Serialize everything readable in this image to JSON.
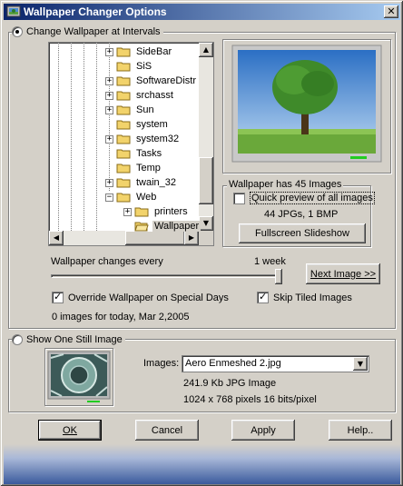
{
  "window": {
    "title": "Wallpaper Changer Options",
    "close_glyph": "✕"
  },
  "intervals": {
    "radio_label": "Change Wallpaper at Intervals",
    "selected": true,
    "tree": [
      {
        "label": "SideBar",
        "expandable": true
      },
      {
        "label": "SiS",
        "expandable": false
      },
      {
        "label": "SoftwareDistr",
        "expandable": true
      },
      {
        "label": "srchasst",
        "expandable": true
      },
      {
        "label": "Sun",
        "expandable": true
      },
      {
        "label": "system",
        "expandable": false
      },
      {
        "label": "system32",
        "expandable": true
      },
      {
        "label": "Tasks",
        "expandable": false
      },
      {
        "label": "Temp",
        "expandable": false
      },
      {
        "label": "twain_32",
        "expandable": true
      },
      {
        "label": "Web",
        "expandable": true,
        "expanded": true
      },
      {
        "label": "printers",
        "expandable": true,
        "child": true
      },
      {
        "label": "Wallpaper",
        "expandable": false,
        "child": true,
        "selected": true
      }
    ],
    "group_title": "Wallpaper has 45 Images",
    "quick_preview_label": "Quick preview of all images",
    "quick_preview_checked": false,
    "image_counts": "44 JPGs, 1 BMP",
    "fullscreen_button": "Fullscreen Slideshow",
    "changes_every_label": "Wallpaper changes every",
    "interval_value": "1 week",
    "interval_slider_level": 1.0,
    "next_image_button": "Next Image >>",
    "override_label": "Override Wallpaper on Special Days",
    "override_checked": true,
    "skip_tiled_label": "Skip Tiled Images",
    "skip_tiled_checked": true,
    "today_status": "0 images for today, Mar 2,2005"
  },
  "still": {
    "radio_label": "Show One Still Image",
    "selected": false,
    "images_label": "Images:",
    "selected_image": "Aero Enmeshed 2.jpg",
    "file_info": "241.9 Kb  JPG Image",
    "dimensions_info": "1024 x 768 pixels   16 bits/pixel"
  },
  "buttons": {
    "ok": "OK",
    "cancel": "Cancel",
    "apply": "Apply",
    "help": "Help.."
  },
  "colors": {
    "titlebar_start": "#0a246a",
    "titlebar_end": "#a6caf0",
    "face": "#d4d0c8",
    "folder": "#f2d36b"
  }
}
